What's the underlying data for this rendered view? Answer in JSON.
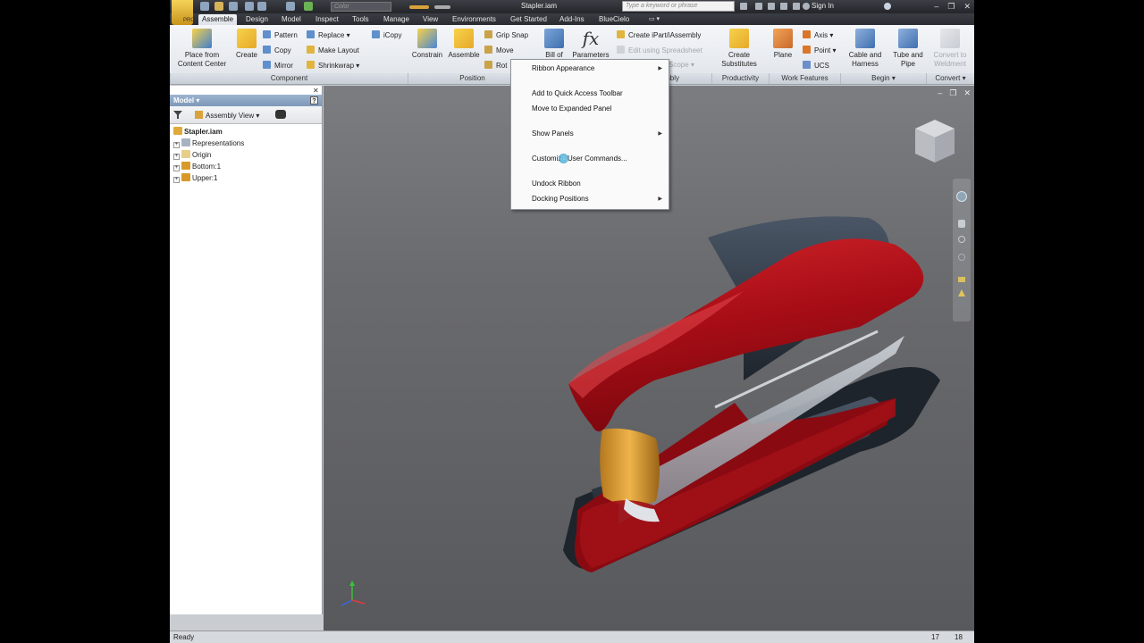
{
  "app": {
    "logo_text": "PRO",
    "document_title": "Stapler.iam"
  },
  "quick_access": {
    "color_placeholder": "Color"
  },
  "search": {
    "placeholder": "Type a keyword or phrase"
  },
  "user": {
    "sign_in": "Sign In"
  },
  "tabs": [
    "Assemble",
    "Design",
    "Model",
    "Inspect",
    "Tools",
    "Manage",
    "View",
    "Environments",
    "Get Started",
    "Add-Ins",
    "BlueCielo"
  ],
  "ribbon": {
    "component": {
      "place_label_1": "Place from",
      "place_label_2": "Content Center",
      "create": "Create",
      "pattern": "Pattern",
      "copy": "Copy",
      "mirror": "Mirror",
      "replace": "Replace",
      "make_layout": "Make Layout",
      "shrinkwrap": "Shrinkwrap",
      "icopy": "iCopy",
      "title": "Component"
    },
    "position": {
      "constrain": "Constrain",
      "assemble": "Assemble",
      "grip_snap": "Grip Snap",
      "move": "Move",
      "rotate": "Rot",
      "title": "Position"
    },
    "manage": {
      "bill_of": "Bill of",
      "parameters": "Parameters",
      "create_ipart": "Create iPart/iAssembly",
      "edit_spreadsheet": "Edit using Spreadsheet",
      "scope": "Scope",
      "title": "mbly"
    },
    "productivity": {
      "create_1": "Create",
      "create_2": "Substitutes",
      "title": "Productivity"
    },
    "work_features": {
      "plane": "Plane",
      "axis": "Axis",
      "point": "Point",
      "ucs": "UCS",
      "title": "Work Features"
    },
    "begin": {
      "cable_1": "Cable and",
      "cable_2": "Harness",
      "tube_1": "Tube and",
      "tube_2": "Pipe",
      "title": "Begin"
    },
    "convert": {
      "convert_1": "Convert to",
      "convert_2": "Weldment",
      "title": "Convert"
    }
  },
  "context_menu": {
    "ribbon_appearance": "Ribbon Appearance",
    "add_qat": "Add to Quick Access Toolbar",
    "move_expanded": "Move to Expanded Panel",
    "show_panels": "Show Panels",
    "customize": "Customize User Commands...",
    "undock": "Undock Ribbon",
    "docking": "Docking Positions"
  },
  "browser": {
    "header": "Model",
    "view_mode": "Assembly View",
    "tree": [
      {
        "label": "Stapler.iam",
        "level": 0
      },
      {
        "label": "Representations",
        "level": 1
      },
      {
        "label": "Origin",
        "level": 1
      },
      {
        "label": "Bottom:1",
        "level": 1
      },
      {
        "label": "Upper:1",
        "level": 1
      }
    ]
  },
  "statusbar": {
    "ready": "Ready",
    "n1": "17",
    "n2": "18"
  },
  "colors": {
    "title_bg": "#2b2d32",
    "ribbon_bg": "#e8ebf0",
    "viewport_top": "#7c7d80",
    "viewport_bottom": "#58595c",
    "stapler_red": "#b0111a",
    "stapler_dark": "#2c3440"
  }
}
